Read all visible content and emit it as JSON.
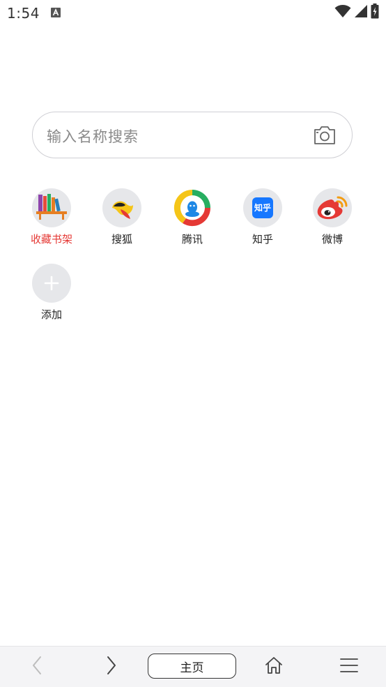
{
  "status_bar": {
    "time": "1:54",
    "icons": [
      "app-notification-icon",
      "wifi-icon",
      "signal-icon",
      "battery-charging-icon"
    ]
  },
  "search": {
    "placeholder": "输入名称搜索",
    "icon": "camera-icon"
  },
  "shortcuts": [
    {
      "label": "收藏书架",
      "icon": "bookshelf-icon",
      "label_color": "#e53935"
    },
    {
      "label": "搜狐",
      "icon": "sohu-icon"
    },
    {
      "label": "腾讯",
      "icon": "tencent-icon"
    },
    {
      "label": "知乎",
      "icon": "zhihu-icon",
      "icon_text": "知乎"
    },
    {
      "label": "微博",
      "icon": "weibo-icon"
    },
    {
      "label": "添加",
      "icon": "add-icon"
    }
  ],
  "bottom_bar": {
    "back_icon": "chevron-left-icon",
    "forward_icon": "chevron-right-icon",
    "home_label": "主页",
    "home_icon": "house-icon",
    "menu_icon": "menu-icon"
  },
  "colors": {
    "accent_red": "#e53935",
    "icon_bg": "#e6e7ea",
    "bottom_bar_bg": "#f4f4f6"
  }
}
